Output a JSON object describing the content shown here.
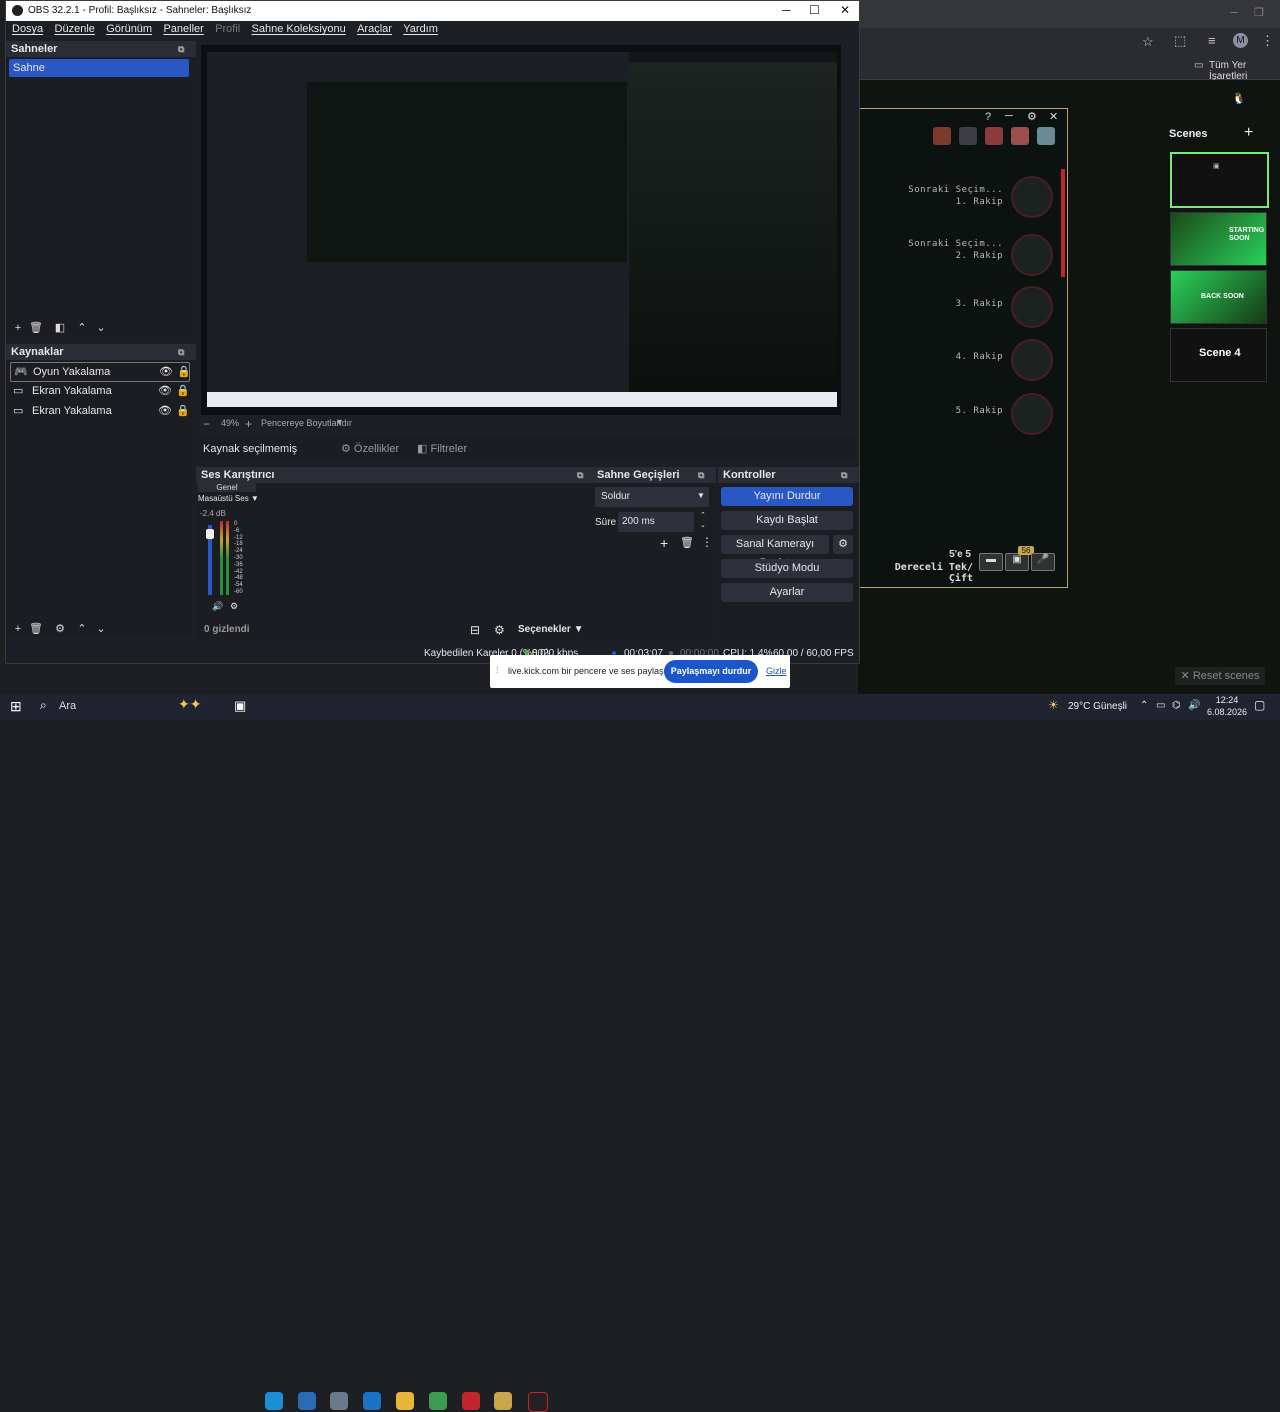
{
  "obs": {
    "title": "OBS 32.2.1 - Profil: Başlıksız - Sahneler: Başlıksız",
    "menu": [
      "Dosya",
      "Düzenle",
      "Görünüm",
      "Paneller",
      "Profil",
      "Sahne Koleksiyonu",
      "Araçlar",
      "Yardım"
    ],
    "window_controls": [
      "─",
      "☐",
      "✕"
    ],
    "scenes": {
      "header": "Sahneler",
      "items": [
        "Sahne"
      ]
    },
    "sources": {
      "header": "Kaynaklar",
      "items": [
        {
          "label": "Oyun Yakalama",
          "icon": "gamepad-icon"
        },
        {
          "label": "Ekran Yakalama",
          "icon": "monitor-icon"
        },
        {
          "label": "Ekran Yakalama",
          "icon": "monitor-icon"
        }
      ]
    },
    "zoom": {
      "value": "49%",
      "fit_label": "Pencereye Boyutlandır"
    },
    "source_bar": {
      "no_source": "Kaynak seçilmemiş",
      "properties": "Özellikler",
      "filters": "Filtreler"
    },
    "mixer": {
      "header": "Ses Karıştırıcı",
      "tab": "Genel",
      "channel": "Masaüstü Ses",
      "db": "-2.4 dB",
      "ticks": [
        "0",
        "-6",
        "-12",
        "-18",
        "-24",
        "-30",
        "-36",
        "-42",
        "-48",
        "-54",
        "-60"
      ],
      "hidden": "0 gizlendi",
      "options": "Seçenekler"
    },
    "transitions": {
      "header": "Sahne Geçişleri",
      "type": "Soldur",
      "duration_label": "Süre",
      "duration": "200 ms"
    },
    "controls": {
      "header": "Kontroller",
      "stop_stream": "Yayını Durdur",
      "start_record": "Kaydı Başlat",
      "virtual_cam": "Sanal Kamerayı Başlat",
      "studio_mode": "Stüdyo Modu",
      "settings": "Ayarlar"
    },
    "status": {
      "dropped": "Kaybedilen Kareler 0 (%0,0)",
      "bitrate": "8020 kbps",
      "stream_time": "00:03:07",
      "rec_time": "00:00:00",
      "cpu": "CPU: 1.4%",
      "fps": "60,00 / 60,00 FPS"
    }
  },
  "share_bar": {
    "text": "live.kick.com bir pencere ve ses paylaşıyor.",
    "stop": "Paylaşmayı durdur",
    "hide": "Gizle"
  },
  "browser": {
    "bookmarks": "Tüm Yer İşaretleri",
    "avatar": "M",
    "overlay": {
      "rows": [
        {
          "title": "Sonraki Seçim...",
          "sub": "1. Rakip"
        },
        {
          "title": "Sonraki Seçim...",
          "sub": "2. Rakip"
        },
        {
          "title": "",
          "sub": "3. Rakip"
        },
        {
          "title": "",
          "sub": "4. Rakip"
        },
        {
          "title": "",
          "sub": "5. Rakip"
        }
      ],
      "mode_line1": "5'e 5",
      "mode_line2": "Dereceli Tek/Çift",
      "badge": "56",
      "help": "?"
    },
    "scenes_panel": {
      "header": "Scenes",
      "add": "+",
      "items": [
        "",
        "STARTING SOON",
        "BACK SOON",
        "Scene 4"
      ],
      "reset": "Reset scenes"
    }
  },
  "taskbar": {
    "search": "Ara",
    "weather": "29°C  Güneşli",
    "time": "12:24",
    "date": "6.08.2026"
  },
  "colors": {
    "accent": "#2957c3",
    "obs_bg": "#1d1f26",
    "panel_header": "#2a2d36",
    "overlay_border": "#b8a46a"
  }
}
